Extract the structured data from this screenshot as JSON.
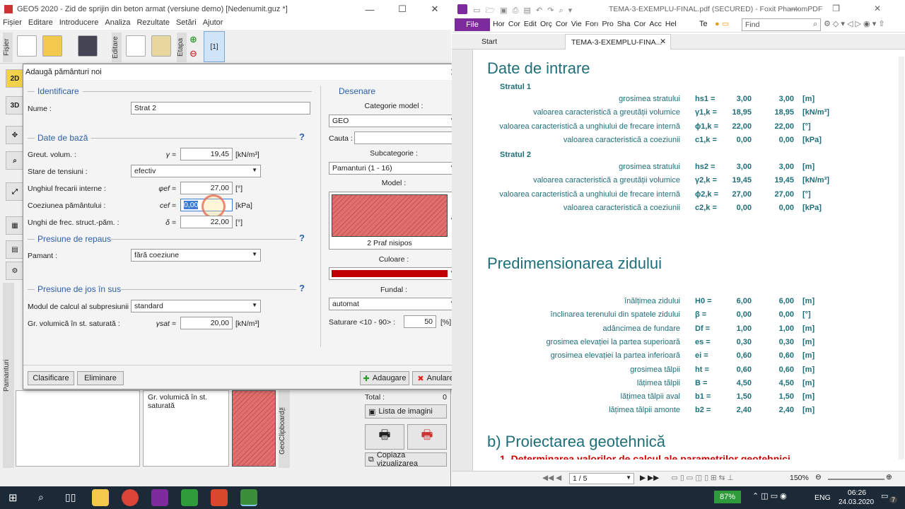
{
  "geo": {
    "title": "GEO5 2020 - Zid de sprijin din beton armat (versiune demo) [Nedenumit.guz *]",
    "menu": [
      "Fișier",
      "Editare",
      "Introducere",
      "Analiza",
      "Rezultate",
      "Setări",
      "Ajutor"
    ],
    "toolbar": {
      "fisier": "Fișier",
      "editare": "Editare",
      "etapa": "Etapa",
      "stage": "[1]"
    },
    "side": {
      "b2d": "2D",
      "b3d": "3D",
      "pamanturi": "Pamanturi",
      "clipboard": "GeoClipboard™"
    },
    "lower": {
      "col_label": "Gr. volumică în st. saturată",
      "total_label": "Total :",
      "total_value": "0",
      "lista": "Lista de imagini",
      "copiaza": "Copiaza vizualizarea"
    }
  },
  "dialog": {
    "title": "Adaugă pământuri noi",
    "identificare": "Identificare",
    "nume_label": "Nume :",
    "nume_value": "Strat 2",
    "date_baza": "Date de bază",
    "greut_label": "Greut. volum. :",
    "greut_sym": "γ =",
    "greut_value": "19,45",
    "greut_unit": "[kN/m³]",
    "stare_label": "Stare de tensiuni :",
    "stare_value": "efectiv",
    "unghi_label": "Unghiul frecarii interne :",
    "unghi_sym": "φef =",
    "unghi_value": "27,00",
    "unghi_unit": "[°]",
    "coez_label": "Coeziunea pământului :",
    "coez_sym": "cef =",
    "coez_value": "0,00",
    "coez_unit": "[kPa]",
    "delta_label": "Unghi de frec. struct.-păm. :",
    "delta_sym": "δ =",
    "delta_value": "22,00",
    "delta_unit": "[°]",
    "repaus": "Presiune de repaus",
    "pamant_label": "Pamant :",
    "pamant_value": "fără coeziune",
    "jos": "Presiune de jos în sus",
    "modul_label": "Modul de calcul al subpresiunii :",
    "modul_value": "standard",
    "sat_label": "Gr. volumică în st. saturată :",
    "sat_sym": "γsat =",
    "sat_value": "20,00",
    "sat_unit": "[kN/m³]",
    "desenare": "Desenare",
    "categorie_label": "Categorie model :",
    "categorie_value": "GEO",
    "cauta_label": "Cauta :",
    "subcat_label": "Subcategorie :",
    "subcat_value": "Pamanturi (1 - 16)",
    "model_label": "Model :",
    "model_value": "2 Praf nisipos",
    "culoare_label": "Culoare :",
    "fundal_label": "Fundal :",
    "fundal_value": "automat",
    "saturare_label": "Saturare <10 - 90> :",
    "saturare_value": "50",
    "saturare_unit": "[%]",
    "clasificare": "Clasificare",
    "eliminare": "Eliminare",
    "adaugare": "Adaugare",
    "anulare": "Anulare",
    "help": "?"
  },
  "foxit": {
    "title": "TEMA-3-EXEMPLU-FINAL.pdf (SECURED) - Foxit PhantomPDF",
    "file": "File",
    "ribbon": [
      "Hor",
      "Cor",
      "Edit",
      "Orç",
      "Cor",
      "Vie",
      "Forı",
      "Pro",
      "Sha",
      "Cor",
      "Acc",
      "Hel"
    ],
    "te": "Te",
    "find": "Find",
    "tabs": [
      "Start",
      "TEMA-3-EXEMPLU-FINA..."
    ],
    "page": "1 / 5",
    "zoom": "150%"
  },
  "doc": {
    "h_date": "Date de intrare",
    "strat1": "Stratul 1",
    "strat2": "Stratul 2",
    "rows1": [
      {
        "d": "grosimea stratului",
        "s": "hs1 =",
        "v1": "3,00",
        "v2": "3,00",
        "u": "[m]"
      },
      {
        "d": "valoarea caracteristică a greutății volumice",
        "s": "γ1,k =",
        "v1": "18,95",
        "v2": "18,95",
        "u": "[kN/m³]"
      },
      {
        "d": "valoarea caracteristică a unghiului de frecare internă",
        "s": "ϕ1,k =",
        "v1": "22,00",
        "v2": "22,00",
        "u": "[°]"
      },
      {
        "d": "valoarea caracteristică a coeziunii",
        "s": "c1,k =",
        "v1": "0,00",
        "v2": "0,00",
        "u": "[kPa]"
      }
    ],
    "rows2": [
      {
        "d": "grosimea stratului",
        "s": "hs2 =",
        "v1": "3,00",
        "v2": "3,00",
        "u": "[m]"
      },
      {
        "d": "valoarea caracteristică a greutății volumice",
        "s": "γ2,k =",
        "v1": "19,45",
        "v2": "19,45",
        "u": "[kN/m³]"
      },
      {
        "d": "valoarea caracteristică a unghiului de frecare internă",
        "s": "ϕ2,k =",
        "v1": "27,00",
        "v2": "27,00",
        "u": "[°]"
      },
      {
        "d": "valoarea caracteristică a coeziunii",
        "s": "c2,k =",
        "v1": "0,00",
        "v2": "0,00",
        "u": "[kPa]"
      }
    ],
    "h_predim": "Predimensionarea zidului",
    "rows3": [
      {
        "d": "înălțimea zidului",
        "s": "H0 =",
        "v1": "6,00",
        "v2": "6,00",
        "u": "[m]"
      },
      {
        "d": "înclinarea terenului din spatele zidului",
        "s": "β =",
        "v1": "0,00",
        "v2": "0,00",
        "u": "[°]"
      },
      {
        "d": "adâncimea de fundare",
        "s": "Df =",
        "v1": "1,00",
        "v2": "1,00",
        "u": "[m]"
      },
      {
        "d": "grosimea elevației la partea superioară",
        "s": "es =",
        "v1": "0,30",
        "v2": "0,30",
        "u": "[m]"
      },
      {
        "d": "grosimea elevației la partea inferioară",
        "s": "ei =",
        "v1": "0,60",
        "v2": "0,60",
        "u": "[m]"
      },
      {
        "d": "grosimea tălpii",
        "s": "ht =",
        "v1": "0,60",
        "v2": "0,60",
        "u": "[m]"
      },
      {
        "d": "lățimea tălpii",
        "s": "B =",
        "v1": "4,50",
        "v2": "4,50",
        "u": "[m]"
      },
      {
        "d": "lățimea tălpii aval",
        "s": "b1 =",
        "v1": "1,50",
        "v2": "1,50",
        "u": "[m]"
      },
      {
        "d": "lățimea tălpii amonte",
        "s": "b2 =",
        "v1": "2,40",
        "v2": "2,40",
        "u": "[m]"
      }
    ],
    "h_proiect": "b) Proiectarea geotehnică",
    "h_determ": "1. Determinarea valorilor de calcul ale parametrilor geotehnici"
  },
  "taskbar": {
    "battery": "87%",
    "lang": "ENG",
    "time": "06:26",
    "date": "24.03.2020",
    "notif": "7"
  },
  "colors": {
    "accent": "#2a5ea8",
    "teal": "#1f6f7a",
    "foxit": "#7d2a9c",
    "hatch": "#e07070",
    "culoare": "#c00000"
  }
}
